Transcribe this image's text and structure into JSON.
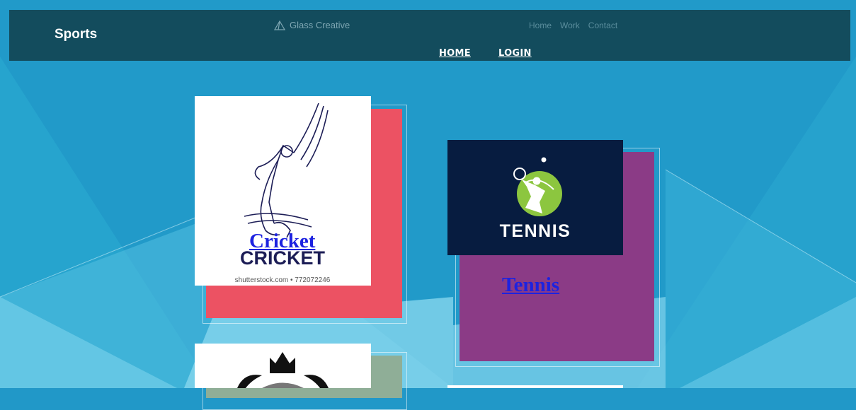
{
  "navbar": {
    "brand": "Sports",
    "template_name": "Glass Creative",
    "top_links": [
      "Home",
      "Work",
      "Contact"
    ],
    "main_links": [
      "HOME",
      "LOGIN"
    ]
  },
  "cards": [
    {
      "link": "Cricket",
      "image_title": "CRICKET",
      "image_caption": "shutterstock.com • 772072246",
      "color": "#ec5263"
    },
    {
      "link": "Tennis",
      "image_title": "TENNIS",
      "color": "#8b3b86"
    }
  ],
  "colors": {
    "background": "#2198c8",
    "navbar": "#134c5d",
    "cricket_card": "#ec5263",
    "tennis_card": "#8b3b86",
    "tennis_image_bg": "#071c40",
    "third_card": "#8fae97"
  }
}
